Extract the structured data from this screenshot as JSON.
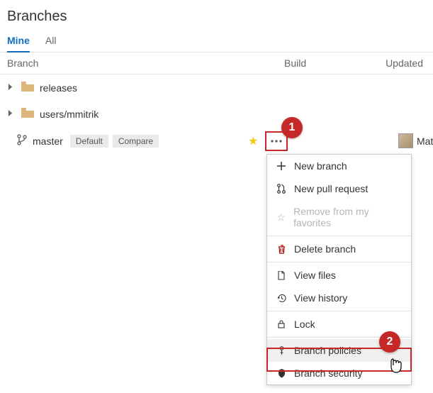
{
  "header": {
    "title": "Branches"
  },
  "tabs": [
    {
      "label": "Mine",
      "active": true
    },
    {
      "label": "All",
      "active": false
    }
  ],
  "columns": {
    "branch": "Branch",
    "build": "Build",
    "updated": "Updated"
  },
  "rows": {
    "releases": {
      "name": "releases"
    },
    "users": {
      "name": "users/mmitrik"
    },
    "master": {
      "name": "master",
      "default_badge": "Default",
      "compare_badge": "Compare",
      "author": "Matt"
    }
  },
  "menu": {
    "new_branch": "New branch",
    "new_pr": "New pull request",
    "remove_fav": "Remove from my favorites",
    "delete": "Delete branch",
    "view_files": "View files",
    "view_history": "View history",
    "lock": "Lock",
    "policies": "Branch policies",
    "security": "Branch security"
  },
  "callouts": {
    "c1": "1",
    "c2": "2"
  }
}
